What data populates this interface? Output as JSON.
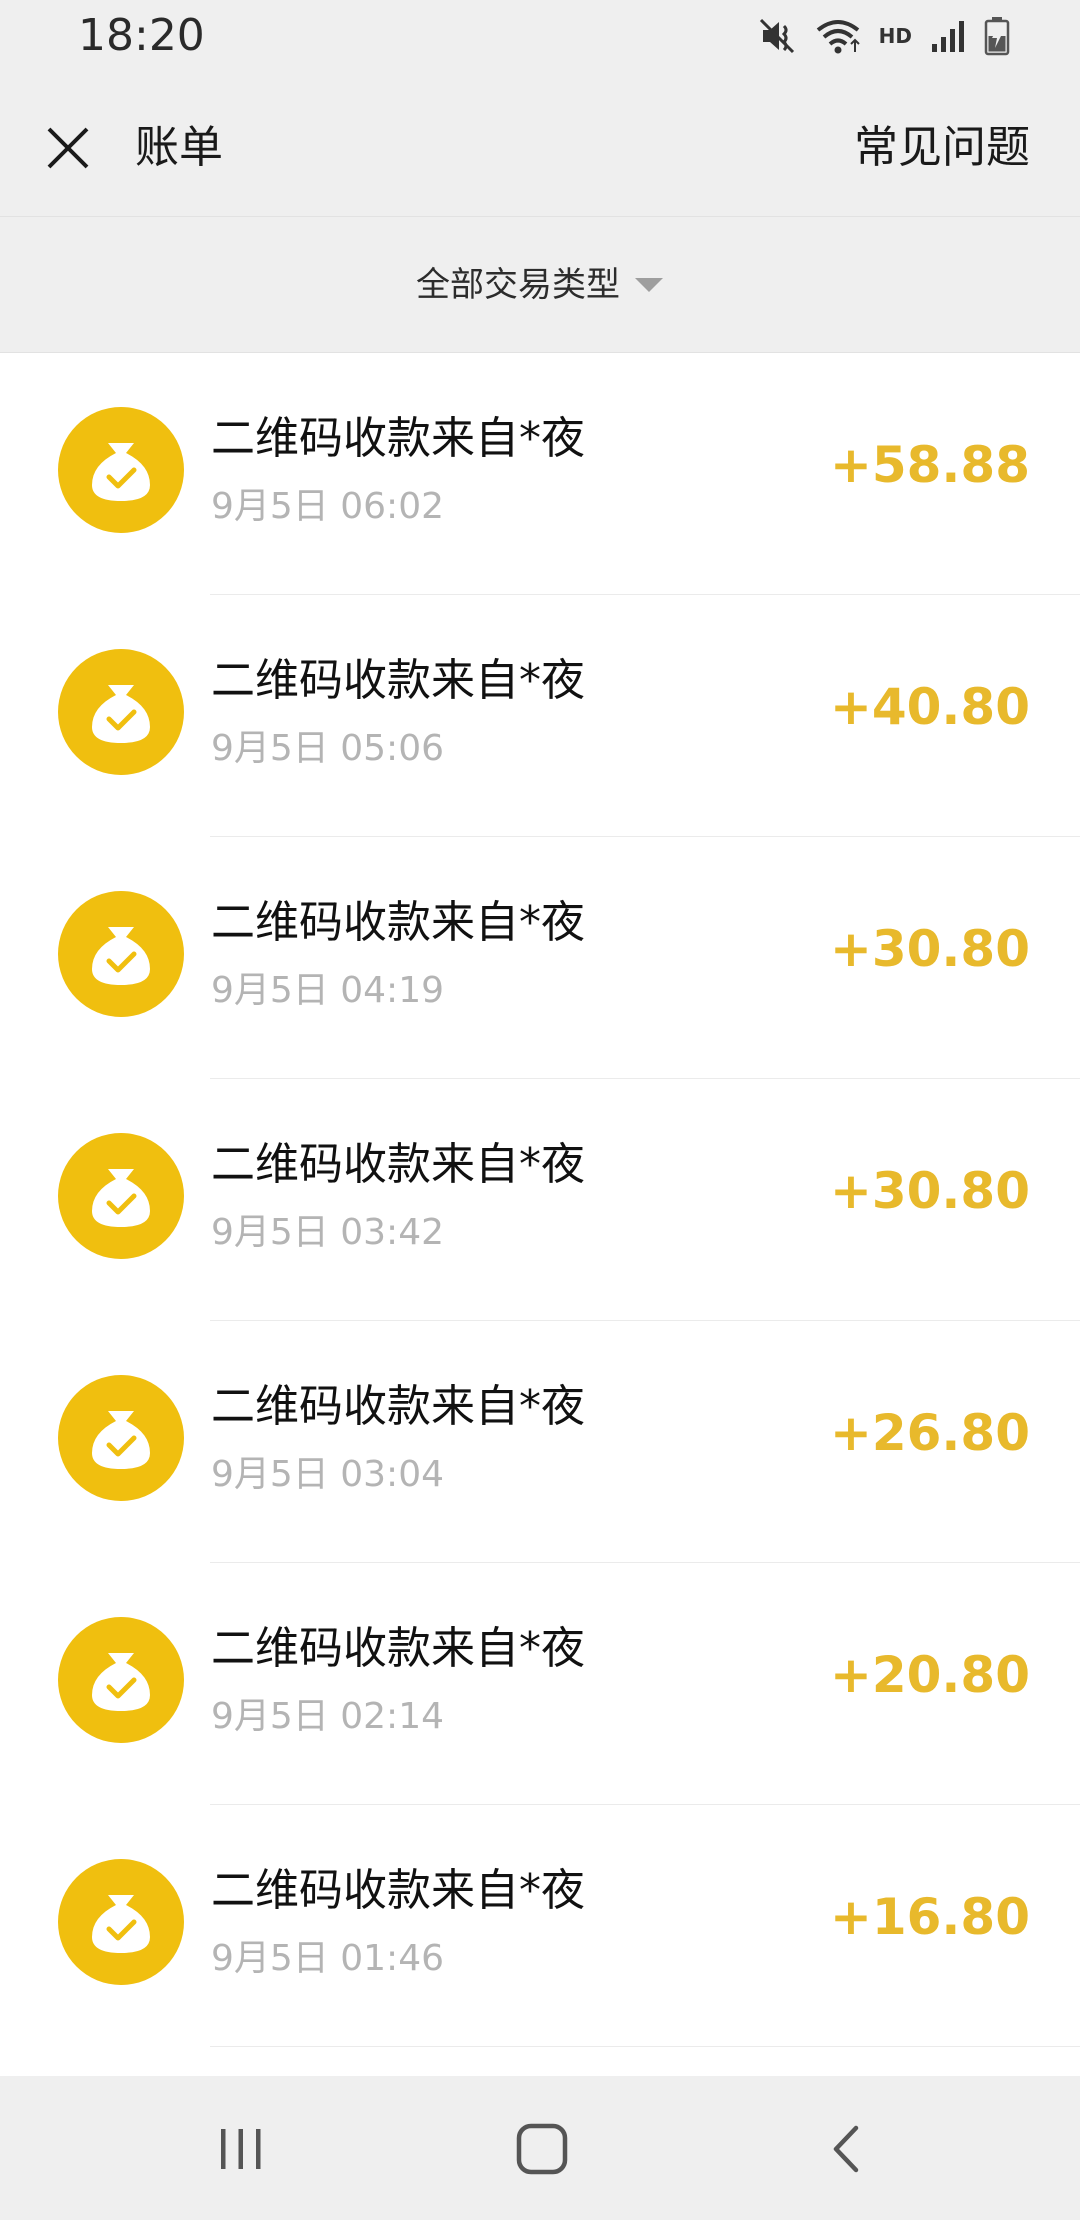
{
  "status_bar": {
    "time": "18:20",
    "network_label": "HD",
    "icons": [
      "mute-icon",
      "wifi-icon",
      "signal-icon",
      "battery-charging-icon"
    ]
  },
  "header": {
    "title": "账单",
    "faq_label": "常见问题",
    "close_icon": "close-icon"
  },
  "filter": {
    "label": "全部交易类型",
    "icon": "caret-down-icon"
  },
  "transactions": [
    {
      "title": "二维码收款来自*夜",
      "time": "9月5日 06:02",
      "amount": "+58.88"
    },
    {
      "title": "二维码收款来自*夜",
      "time": "9月5日 05:06",
      "amount": "+40.80"
    },
    {
      "title": "二维码收款来自*夜",
      "time": "9月5日 04:19",
      "amount": "+30.80"
    },
    {
      "title": "二维码收款来自*夜",
      "time": "9月5日 03:42",
      "amount": "+30.80"
    },
    {
      "title": "二维码收款来自*夜",
      "time": "9月5日 03:04",
      "amount": "+26.80"
    },
    {
      "title": "二维码收款来自*夜",
      "time": "9月5日 02:14",
      "amount": "+20.80"
    },
    {
      "title": "二维码收款来自*夜",
      "time": "9月5日 01:46",
      "amount": "+16.80"
    }
  ],
  "nav_bar": {
    "icons": [
      "recents-icon",
      "home-icon",
      "back-icon"
    ]
  },
  "colors": {
    "accent": "#e8b92c",
    "icon_bg": "#f0bf0f",
    "chrome_bg": "#efefef",
    "time_gray": "#b4b4b4"
  }
}
